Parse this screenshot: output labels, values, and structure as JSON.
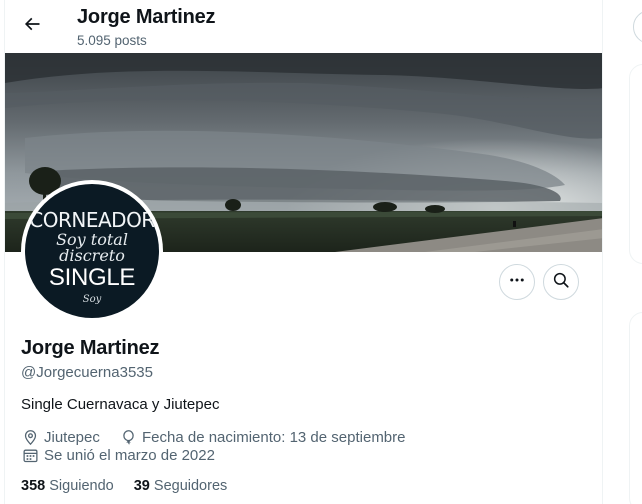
{
  "header": {
    "title": "Jorge Martinez",
    "post_count": "5.095 posts"
  },
  "avatar": {
    "line1": "CORNEADOR",
    "line2": "Soy total",
    "line3": "discreto",
    "line4": "SINGLE",
    "line5": "Soy"
  },
  "profile": {
    "name": "Jorge Martinez",
    "handle": "@Jorgecuerna3535",
    "bio": "Single Cuernavaca y Jiutepec",
    "location": "Jiutepec",
    "birthday": "Fecha de nacimiento: 13 de septiembre",
    "joined": "Se unió el marzo de 2022",
    "following_count": "358",
    "following_label": "Siguiendo",
    "followers_count": "39",
    "followers_label": "Seguidores"
  },
  "icons": {
    "back": "arrow-left-icon",
    "more": "more-dots-icon",
    "search": "search-icon",
    "location": "location-pin-icon",
    "birthday": "balloon-icon",
    "calendar": "calendar-icon"
  },
  "colors": {
    "text_primary": "#0f1419",
    "text_secondary": "#536471",
    "border": "#cfd9de"
  }
}
